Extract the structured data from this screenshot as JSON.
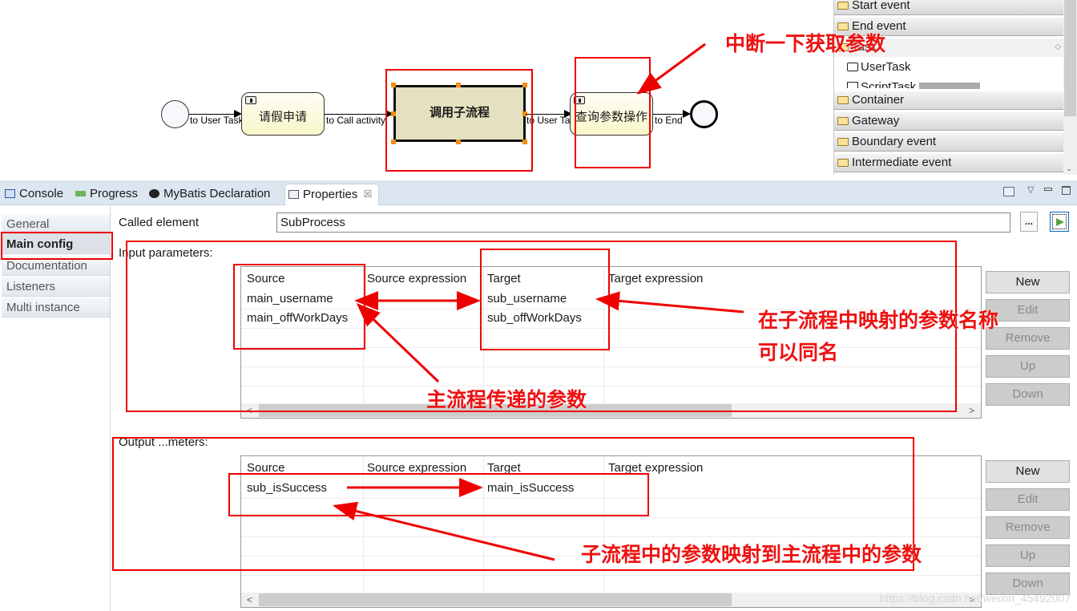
{
  "diagram": {
    "start_event": "start-event",
    "flows": [
      "to User Task",
      "to Call activity",
      "to User Task",
      "to End"
    ],
    "tasks": [
      {
        "label": "请假申请",
        "type": "user-task"
      },
      {
        "label": "调用子流程",
        "type": "call-activity",
        "selected": true
      },
      {
        "label": "查询参数操作",
        "type": "user-task"
      }
    ],
    "end_event": "end-event"
  },
  "palette": {
    "drawers": [
      "Start event",
      "End event",
      "Task",
      "Container",
      "Gateway",
      "Boundary event",
      "Intermediate event"
    ],
    "task_items": [
      "UserTask",
      "ScriptTask"
    ]
  },
  "tabs": [
    {
      "label": "Console",
      "icon": "console-icon"
    },
    {
      "label": "Progress",
      "icon": "progress-icon"
    },
    {
      "label": "MyBatis Declaration",
      "icon": "mybatis-icon"
    },
    {
      "label": "Properties",
      "icon": "properties-icon",
      "active": true,
      "close": "☒"
    }
  ],
  "nav": [
    "General",
    "Main config",
    "Documentation",
    "Listeners",
    "Multi instance"
  ],
  "called_element": {
    "label": "Called element",
    "value": "SubProcess",
    "browse": "..."
  },
  "input_params": {
    "label": "Input parameters:",
    "columns": [
      "Source",
      "Source expression",
      "Target",
      "Target expression"
    ],
    "rows": [
      [
        "main_username",
        "",
        "sub_username",
        ""
      ],
      [
        "main_offWorkDays",
        "",
        "sub_offWorkDays",
        ""
      ]
    ],
    "buttons": [
      "New",
      "Edit",
      "Remove",
      "Up",
      "Down"
    ]
  },
  "output_params": {
    "label": "Output ...meters:",
    "columns": [
      "Source",
      "Source expression",
      "Target",
      "Target expression"
    ],
    "rows": [
      [
        "sub_isSuccess",
        "",
        "main_isSuccess",
        ""
      ]
    ],
    "buttons": [
      "New",
      "Edit",
      "Remove",
      "Up",
      "Down"
    ]
  },
  "annotations": {
    "interrupt": "中断一下获取参数",
    "sub_names_1": "在子流程中映射的参数名称",
    "sub_names_2": "可以同名",
    "main_pass": "主流程传递的参数",
    "sub_to_main": "子流程中的参数映射到主流程中的参数"
  },
  "watermark": "https://blog.csdn.net/weixin_45492007",
  "colors": {
    "annotation": "#ee0000",
    "selection_handle": "#f28c12",
    "call_activity_fill": "#e3e1bf"
  }
}
